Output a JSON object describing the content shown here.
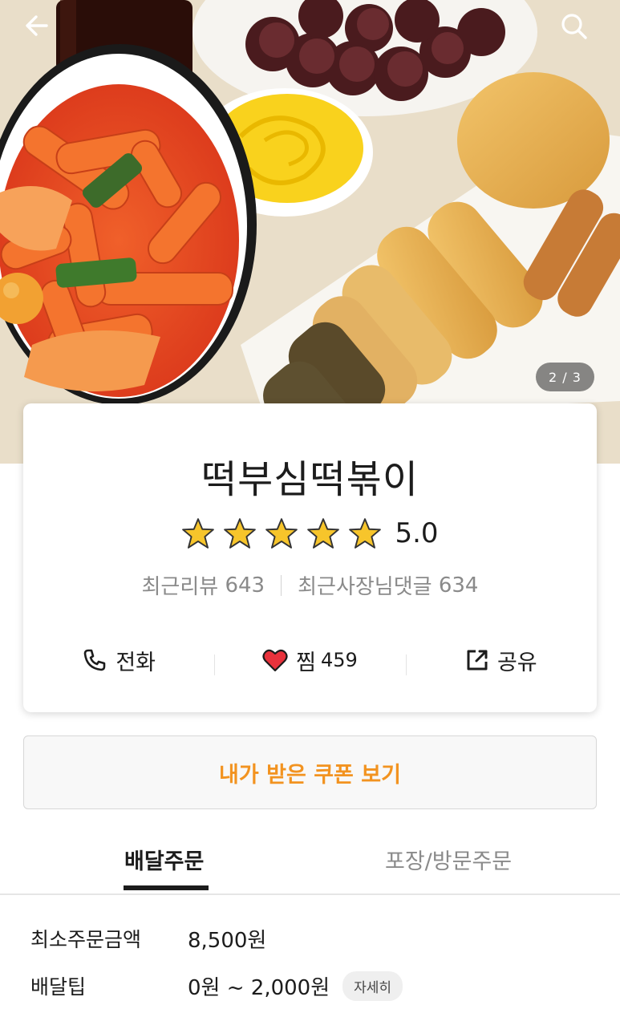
{
  "hero": {
    "image_alt": "떡볶이, 순대, 튀김",
    "pager": "2 / 3"
  },
  "store": {
    "name": "떡부심떡볶이",
    "rating": "5.0",
    "stars": 5,
    "recent_reviews_label": "최근리뷰",
    "recent_reviews_count": "643",
    "owner_replies_label": "최근사장님댓글",
    "owner_replies_count": "634"
  },
  "actions": {
    "call_label": "전화",
    "like_label": "찜",
    "like_count": "459",
    "share_label": "공유"
  },
  "coupon": {
    "label": "내가 받은 쿠폰 보기"
  },
  "tabs": [
    {
      "label": "배달주문",
      "active": true
    },
    {
      "label": "포장/방문주문",
      "active": false
    }
  ],
  "order_info": {
    "min_order_label": "최소주문금액",
    "min_order_value": "8,500원",
    "delivery_tip_label": "배달팁",
    "delivery_tip_value": "0원 ~ 2,000원",
    "detail_label": "자세히"
  },
  "colors": {
    "accent": "#f29320",
    "star": "#f7c52b",
    "heart": "#e8323c"
  },
  "icons": [
    "back-arrow-icon",
    "search-icon",
    "star-icon",
    "phone-icon",
    "heart-icon",
    "share-icon"
  ]
}
